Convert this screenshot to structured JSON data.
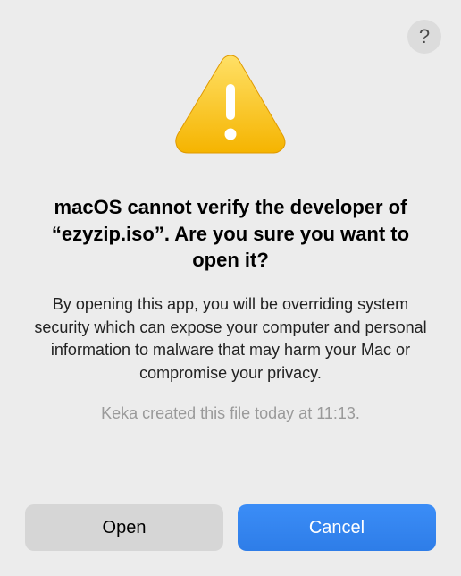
{
  "help": {
    "label": "?"
  },
  "heading": "macOS cannot verify the developer of “ezyzip.iso”. Are you sure you want to open it?",
  "body": "By opening this app, you will be overriding system security which can expose your computer and personal information to malware that may harm your Mac or compromise your privacy.",
  "meta": "Keka created this file today at 11:13.",
  "buttons": {
    "open": "Open",
    "cancel": "Cancel"
  }
}
